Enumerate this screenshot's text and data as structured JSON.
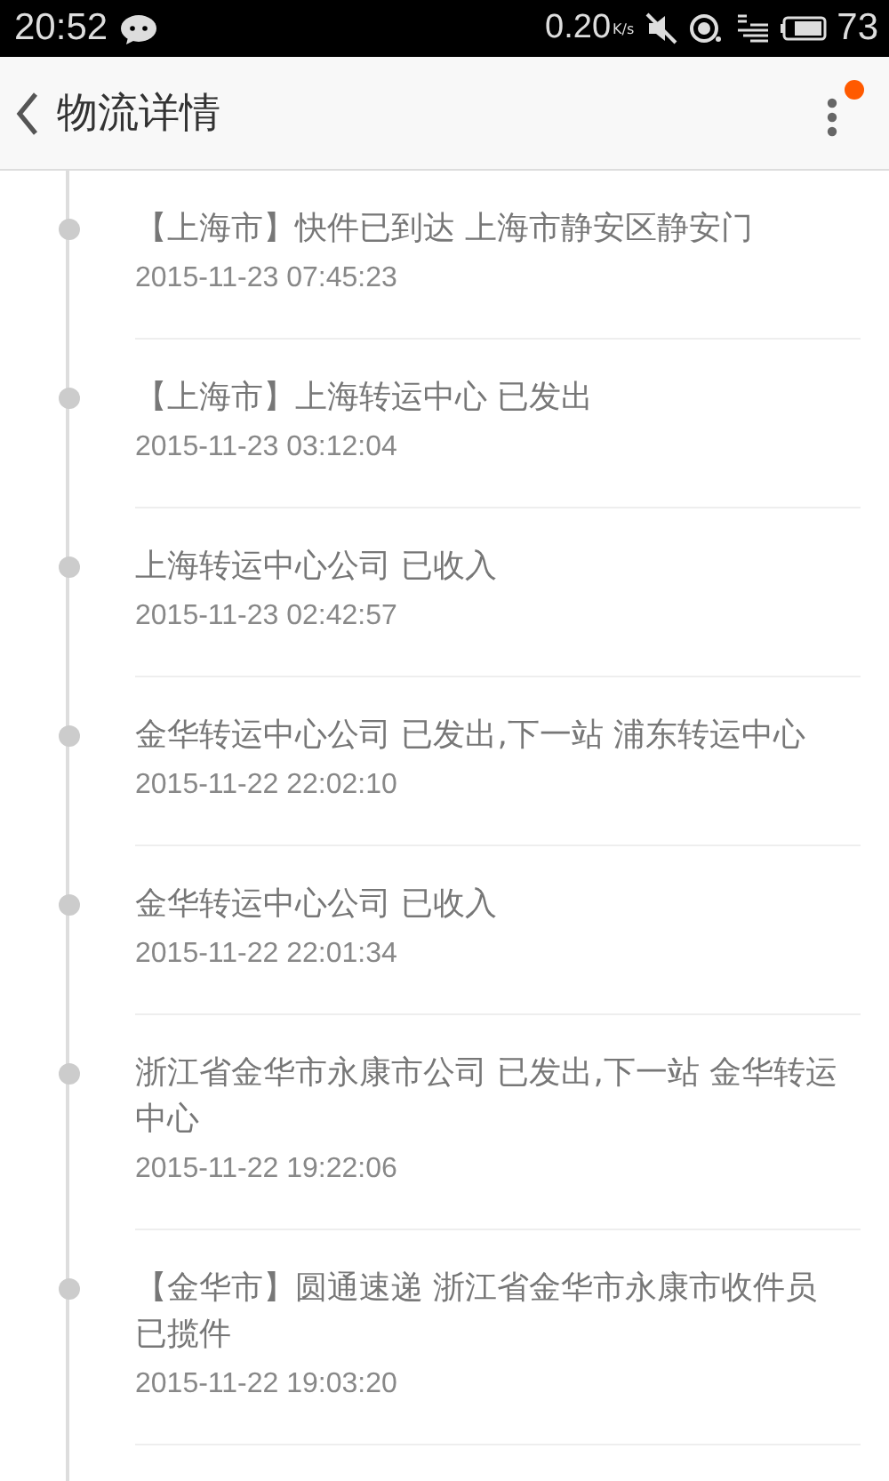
{
  "status_bar": {
    "time": "20:52",
    "speed": "0.20",
    "speed_unit": "K/s",
    "battery": "73"
  },
  "header": {
    "title": "物流详情",
    "menu_badge": true
  },
  "events": [
    {
      "text": "【上海市】快件已到达 上海市静安区静安门",
      "time": "2015-11-23 07:45:23"
    },
    {
      "text": "【上海市】上海转运中心 已发出",
      "time": "2015-11-23 03:12:04"
    },
    {
      "text": "上海转运中心公司 已收入",
      "time": "2015-11-23 02:42:57"
    },
    {
      "text": "金华转运中心公司 已发出,下一站 浦东转运中心",
      "time": "2015-11-22 22:02:10"
    },
    {
      "text": "金华转运中心公司 已收入",
      "time": "2015-11-22 22:01:34"
    },
    {
      "text": "浙江省金华市永康市公司 已发出,下一站 金华转运中心",
      "time": "2015-11-22 19:22:06"
    },
    {
      "text": "【金华市】圆通速递 浙江省金华市永康市收件员已揽件",
      "time": "2015-11-22 19:03:20"
    }
  ]
}
